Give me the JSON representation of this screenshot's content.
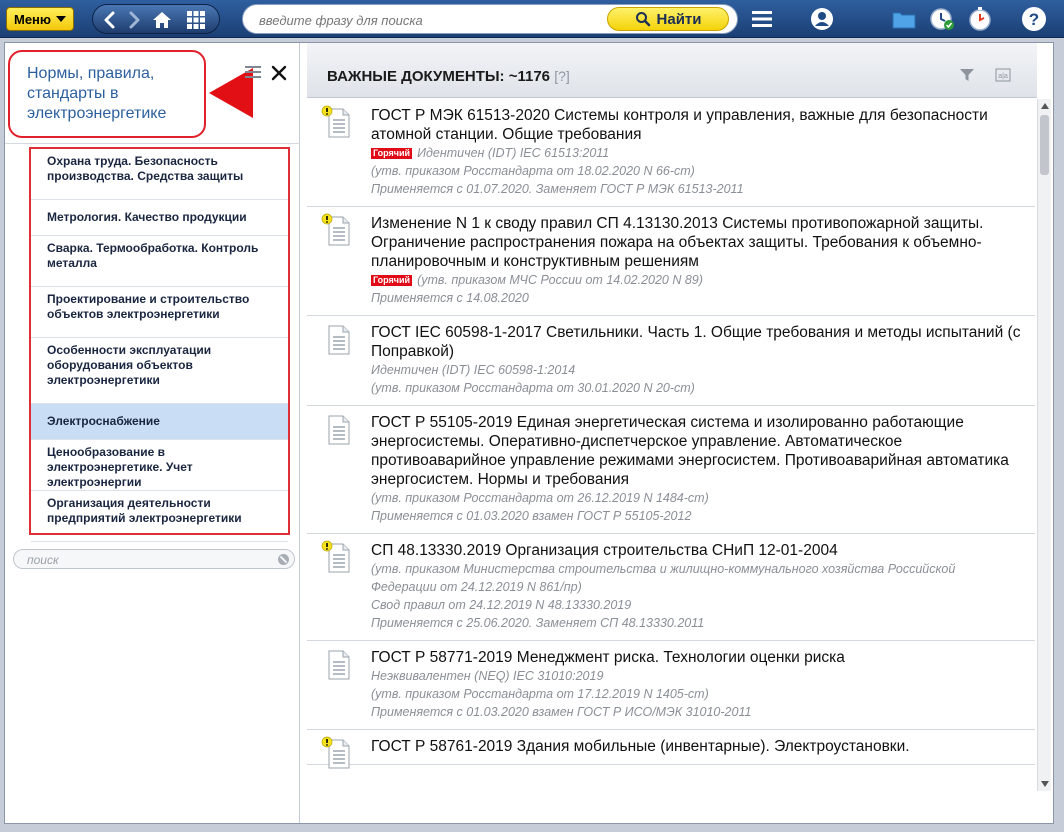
{
  "topbar": {
    "menu_label": "Меню",
    "search_placeholder": "введите фразу для поиска",
    "find_label": "Найти",
    "icons": [
      "back-icon",
      "forward-icon",
      "home-icon",
      "grid-icon",
      "list-icon",
      "user-icon",
      "folder-icon",
      "clock-check-icon",
      "stopwatch-icon",
      "help-icon"
    ]
  },
  "sidebar": {
    "title": "Нормы, правила, стандарты в электроэнергетике",
    "categories": [
      {
        "label": "Охрана труда. Безопасность производства. Средства защиты",
        "selected": false
      },
      {
        "label": "Метрология. Качество продукции",
        "selected": false
      },
      {
        "label": "Сварка. Термообработка. Контроль металла",
        "selected": false
      },
      {
        "label": "Проектирование и строительство объектов электроэнергетики",
        "selected": false
      },
      {
        "label": "Особенности эксплуатации оборудования объектов электроэнергетики",
        "selected": false
      },
      {
        "label": "Электроснабжение",
        "selected": true
      },
      {
        "label": "Ценообразование в электроэнергетике. Учет электроэнергии",
        "selected": false
      },
      {
        "label": "Организация деятельности предприятий электроэнергетики",
        "selected": false
      }
    ],
    "search_placeholder": "поиск"
  },
  "main": {
    "title": "ВАЖНЫЕ ДОКУМЕНТЫ: ~1176",
    "help_mark": "[?]",
    "hot_badge": "Горячий",
    "documents": [
      {
        "title": "ГОСТ Р МЭК 61513-2020 Системы контроля и управления, важные для безопасности атомной станции. Общие требования",
        "alert": true,
        "hot": true,
        "meta": [
          "Идентичен (IDT) IEC 61513:2011",
          "(утв. приказом Росстандарта от 18.02.2020 N 66-ст)",
          "Применяется с 01.07.2020. Заменяет ГОСТ Р МЭК 61513-2011"
        ]
      },
      {
        "title": "Изменение N 1 к своду правил СП 4.13130.2013 Системы противопожарной защиты. Ограничение распространения пожара на объектах защиты. Требования к объемно-планировочным и конструктивным решениям",
        "alert": true,
        "hot": true,
        "meta": [
          "(утв. приказом МЧС России от 14.02.2020 N 89)",
          "Применяется с 14.08.2020"
        ]
      },
      {
        "title": "ГОСТ IEC 60598-1-2017 Светильники. Часть 1. Общие требования и методы испытаний (с Поправкой)",
        "alert": false,
        "hot": false,
        "meta": [
          "Идентичен (IDT) IEC 60598-1:2014",
          "(утв. приказом Росстандарта от 30.01.2020 N 20-ст)"
        ]
      },
      {
        "title": "ГОСТ Р 55105-2019 Единая энергетическая система и изолированно работающие энергосистемы. Оперативно-диспетчерское управление. Автоматическое противоаварийное управление режимами энергосистем. Противоаварийная автоматика энергосистем. Нормы и требования",
        "alert": false,
        "hot": false,
        "meta": [
          "(утв. приказом Росстандарта от 26.12.2019 N 1484-ст)",
          "Применяется с 01.03.2020 взамен ГОСТ Р 55105-2012"
        ]
      },
      {
        "title": "СП 48.13330.2019 Организация строительства СНиП 12-01-2004",
        "alert": true,
        "hot": false,
        "meta": [
          "(утв. приказом Министерства строительства и жилищно-коммунального хозяйства Российской Федерации от 24.12.2019 N 861/пр)",
          "Свод правил от 24.12.2019 N 48.13330.2019",
          "Применяется с 25.06.2020. Заменяет СП 48.13330.2011"
        ]
      },
      {
        "title": "ГОСТ Р 58771-2019 Менеджмент риска. Технологии оценки риска",
        "alert": false,
        "hot": false,
        "meta": [
          "Неэквивалентен (NEQ) IEC 31010:2019",
          "(утв. приказом Росстандарта от 17.12.2019 N 1405-ст)",
          "Применяется с 01.03.2020 взамен ГОСТ Р ИСО/МЭК 31010-2011"
        ]
      },
      {
        "title": "ГОСТ Р 58761-2019 Здания мобильные (инвентарные). Электроустановки.",
        "alert": true,
        "hot": false,
        "meta": []
      }
    ]
  },
  "colors": {
    "topbar": "#1e4a86",
    "accent_yellow": "#f7d51a",
    "callout_red": "#e0202a",
    "selected_bg": "#c9ddf5",
    "hot_red": "#e00b16",
    "link_blue": "#2c5f9e"
  }
}
